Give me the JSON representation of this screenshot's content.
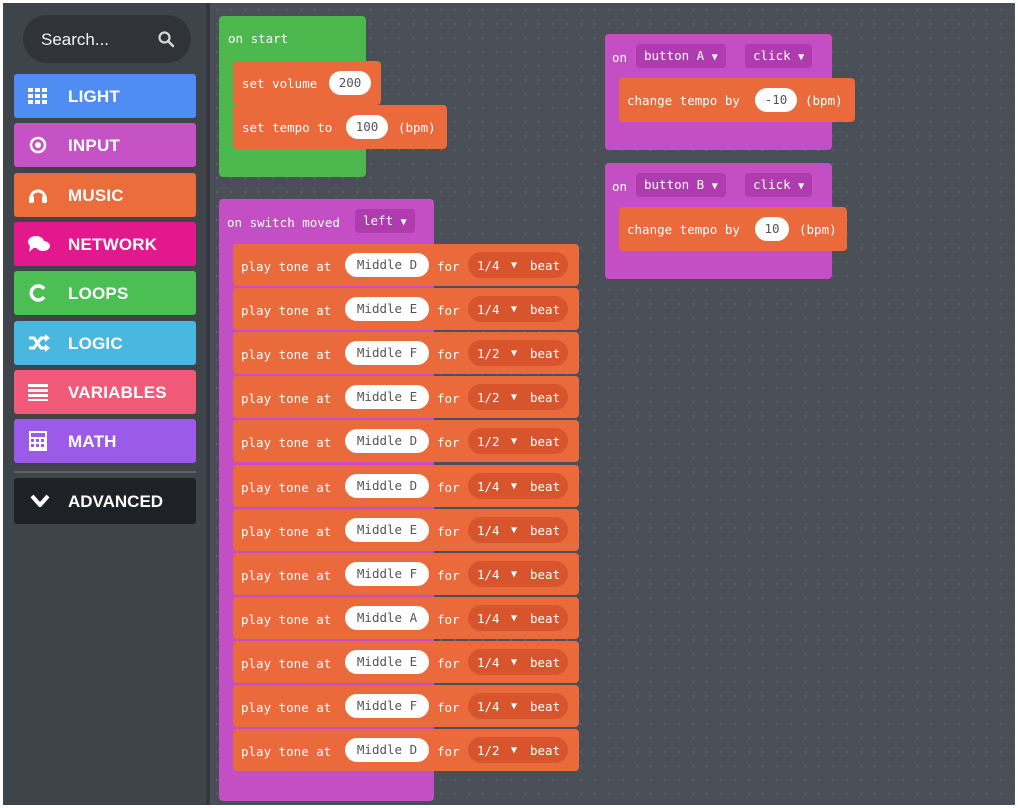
{
  "toolbox": {
    "search_placeholder": "Search...",
    "categories": [
      {
        "label": "LIGHT",
        "icon": "grid-icon",
        "color": "#4f8df2"
      },
      {
        "label": "INPUT",
        "icon": "target-icon",
        "color": "#c653c6"
      },
      {
        "label": "MUSIC",
        "icon": "headphones-icon",
        "color": "#ec6d3c"
      },
      {
        "label": "NETWORK",
        "icon": "chat-icon",
        "color": "#e3188c"
      },
      {
        "label": "LOOPS",
        "icon": "refresh-icon",
        "color": "#4bbf53"
      },
      {
        "label": "LOGIC",
        "icon": "shuffle-icon",
        "color": "#4ab7e0"
      },
      {
        "label": "VARIABLES",
        "icon": "list-icon",
        "color": "#f05a78"
      },
      {
        "label": "MATH",
        "icon": "calculator-icon",
        "color": "#9c5ae8"
      }
    ],
    "advanced_label": "ADVANCED"
  },
  "on_start": {
    "header": "on start",
    "volume_label": "set volume",
    "volume_value": "200",
    "tempo_label": "set tempo to",
    "tempo_value": "100",
    "tempo_unit": "(bpm)"
  },
  "switch_event": {
    "header": "on switch moved",
    "direction": "left",
    "play_label": "play tone at",
    "for_label": "for",
    "beat_label": "beat",
    "tones": [
      {
        "note": "Middle D",
        "duration": "1/4"
      },
      {
        "note": "Middle E",
        "duration": "1/4"
      },
      {
        "note": "Middle F",
        "duration": "1/2"
      },
      {
        "note": "Middle E",
        "duration": "1/2"
      },
      {
        "note": "Middle D",
        "duration": "1/2"
      },
      {
        "note": "Middle D",
        "duration": "1/4"
      },
      {
        "note": "Middle E",
        "duration": "1/4"
      },
      {
        "note": "Middle F",
        "duration": "1/4"
      },
      {
        "note": "Middle A",
        "duration": "1/4"
      },
      {
        "note": "Middle E",
        "duration": "1/4"
      },
      {
        "note": "Middle F",
        "duration": "1/4"
      },
      {
        "note": "Middle D",
        "duration": "1/2"
      }
    ]
  },
  "button_a_event": {
    "on_label": "on",
    "button": "button A",
    "action": "click",
    "change_label": "change tempo by",
    "value": "-10",
    "unit": "(bpm)"
  },
  "button_b_event": {
    "on_label": "on",
    "button": "button B",
    "action": "click",
    "change_label": "change tempo by",
    "value": "10",
    "unit": "(bpm)"
  }
}
